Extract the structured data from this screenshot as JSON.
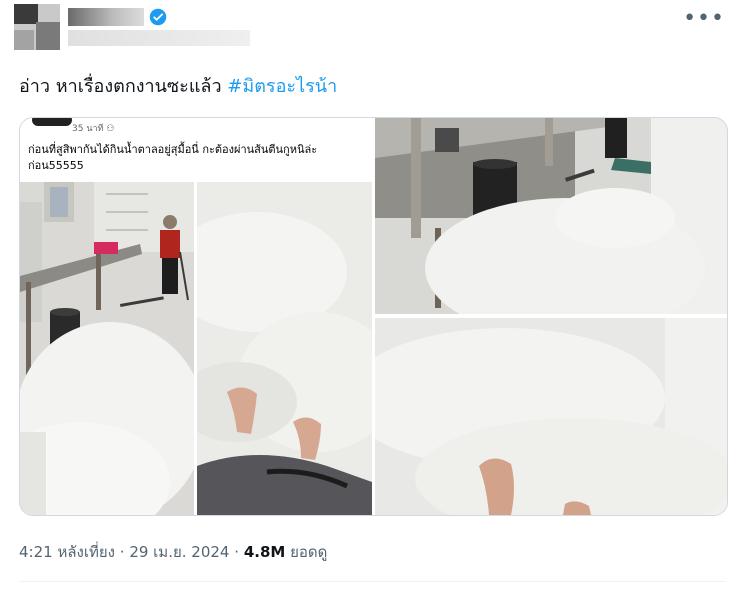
{
  "tweet": {
    "text": "อ่าว หาเรื่องตกงานซะแล้ว",
    "hashtag": "#มิตรอะไรน้า",
    "more_icon": "more-dots-icon",
    "verified_icon": "verified-badge-icon",
    "verified_color": "#1d9bf0"
  },
  "media": {
    "post_time": "35 นาที",
    "post_caption": "ก่อนที่สูสิพากันได้กินน้ำตาลอยู่สุมื้อนี่ กะต้องผ่านส้นตีนกูหนิล่ะก่อน55555"
  },
  "meta": {
    "time": "4:21 หลังเที่ยง",
    "date": "29 เม.ย. 2024",
    "views_count": "4.8M",
    "views_label": "ยอดดู",
    "separator": "·"
  }
}
